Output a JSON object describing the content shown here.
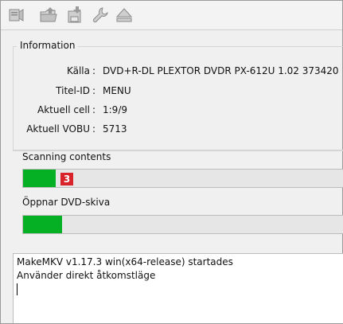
{
  "toolbar": {
    "buttons": [
      {
        "icon": "open-files-icon"
      },
      {
        "icon": "open-disc-icon"
      },
      {
        "icon": "save-icon"
      },
      {
        "icon": "wrench-icon"
      },
      {
        "icon": "eject-icon"
      }
    ]
  },
  "info": {
    "title": "Information",
    "rows": [
      {
        "label": "Källa",
        "sep": ":",
        "value": "DVD+R-DL PLEXTOR DVDR   PX-612U 1.02 373420"
      },
      {
        "label": "Titel-ID",
        "sep": ":",
        "value": "MENU"
      },
      {
        "label": "Aktuell cell",
        "sep": ":",
        "value": "1:9/9"
      },
      {
        "label": "Aktuell VOBU",
        "sep": ":",
        "value": "5713"
      }
    ]
  },
  "scan": {
    "label": "Scanning contents",
    "progress": 0.1,
    "badge": "3"
  },
  "open": {
    "label": "Öppnar DVD-skiva",
    "progress": 0.12
  },
  "log": {
    "lines": [
      "MakeMKV v1.17.3 win(x64-release) startades",
      "Använder direkt åtkomstläge"
    ]
  },
  "colors": {
    "progress_fill": "#06b025",
    "badge": "#d8232a"
  }
}
